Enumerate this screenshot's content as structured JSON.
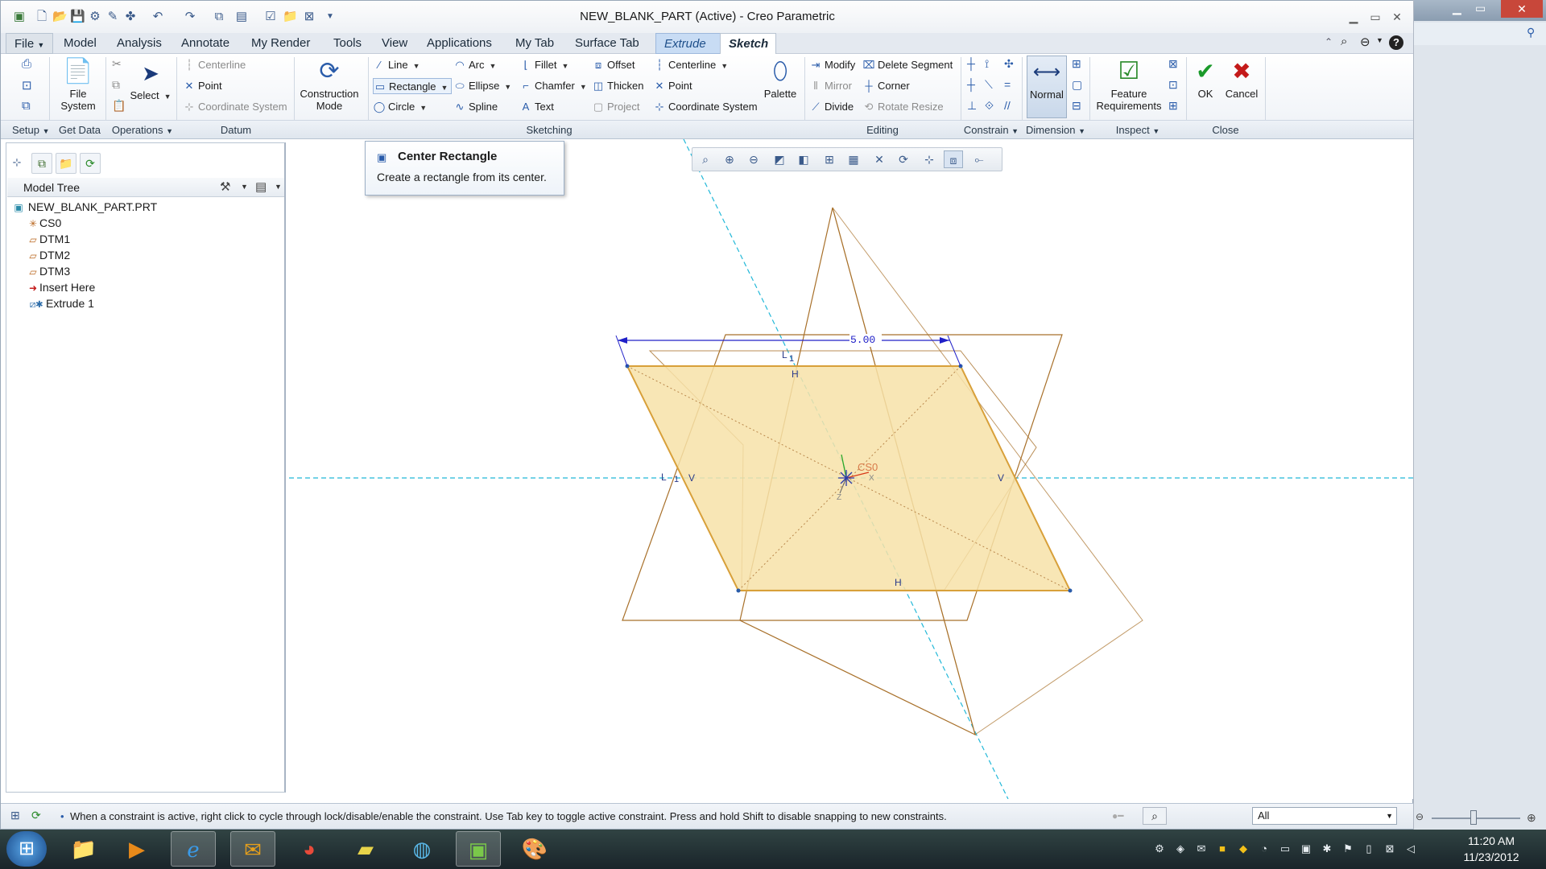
{
  "window": {
    "title": "NEW_BLANK_PART (Active) - Creo Parametric"
  },
  "tabs": [
    {
      "label": "File",
      "state": "file"
    },
    {
      "label": "Model",
      "state": "normal"
    },
    {
      "label": "Analysis",
      "state": "normal"
    },
    {
      "label": "Annotate",
      "state": "normal"
    },
    {
      "label": "My Render",
      "state": "normal"
    },
    {
      "label": "Tools",
      "state": "normal"
    },
    {
      "label": "View",
      "state": "normal"
    },
    {
      "label": "Applications",
      "state": "normal"
    },
    {
      "label": "My Tab",
      "state": "normal"
    },
    {
      "label": "Surface Tab",
      "state": "normal"
    },
    {
      "label": "Extrude",
      "state": "context"
    },
    {
      "label": "Sketch",
      "state": "active"
    }
  ],
  "ribbon": {
    "file_system": "File\nSystem",
    "select": "Select",
    "datum": {
      "centerline": "Centerline",
      "point": "Point",
      "coordinate_system": "Coordinate System"
    },
    "construction_mode": "Construction\nMode",
    "sketching": {
      "line": "Line",
      "rectangle": "Rectangle",
      "circle": "Circle",
      "arc": "Arc",
      "ellipse": "Ellipse",
      "spline": "Spline",
      "fillet": "Fillet",
      "chamfer": "Chamfer",
      "text": "Text",
      "offset": "Offset",
      "thicken": "Thicken",
      "project": "Project",
      "centerline": "Centerline",
      "point": "Point",
      "coordinate_system": "Coordinate System",
      "palette": "Palette"
    },
    "editing": {
      "modify": "Modify",
      "delete_segment": "Delete Segment",
      "mirror": "Mirror",
      "corner": "Corner",
      "divide": "Divide",
      "rotate_resize": "Rotate Resize"
    },
    "dimension": {
      "normal": "Normal"
    },
    "inspect": {
      "feature_requirements": "Feature\nRequirements"
    },
    "close": {
      "ok": "OK",
      "cancel": "Cancel"
    }
  },
  "group_labels": {
    "setup": "Setup",
    "get_data": "Get Data",
    "operations": "Operations",
    "datum": "Datum",
    "sketching": "Sketching",
    "editing": "Editing",
    "constrain": "Constrain",
    "dimension": "Dimension",
    "inspect": "Inspect",
    "close": "Close"
  },
  "model_tree": {
    "title": "Model Tree",
    "items": [
      {
        "label": "NEW_BLANK_PART.PRT",
        "icon": "part-icon",
        "indent": 0
      },
      {
        "label": "CS0",
        "icon": "coordinate-system-icon",
        "indent": 1
      },
      {
        "label": "DTM1",
        "icon": "datum-plane-icon",
        "indent": 1
      },
      {
        "label": "DTM2",
        "icon": "datum-plane-icon",
        "indent": 1
      },
      {
        "label": "DTM3",
        "icon": "datum-plane-icon",
        "indent": 1
      },
      {
        "label": "Insert Here",
        "icon": "insert-arrow-icon",
        "indent": 1
      },
      {
        "label": "Extrude 1",
        "icon": "extrude-icon",
        "indent": 1
      }
    ]
  },
  "tooltip": {
    "title": "Center Rectangle",
    "text": "Create a rectangle from its center."
  },
  "sketch": {
    "dimension": "5.00",
    "cs_label": "CS0",
    "constraint_L": "L",
    "constraint_L1": "1",
    "constraint_H": "H",
    "constraint_V": "V",
    "axis_z": "Z",
    "axis_x": "X"
  },
  "status": {
    "message": "When a constraint is active, right click to cycle through lock/disable/enable the constraint. Use Tab key to toggle active constraint. Press and hold Shift to disable snapping to new constraints.",
    "filter": "All"
  },
  "clock": {
    "time": "11:20 AM",
    "date": "11/23/2012"
  },
  "colors": {
    "sketch_fill": "#f7e2a8",
    "sketch_edge": "#a8702a",
    "dimension": "#2020c8",
    "centerline": "#22b8d8",
    "context_tab": "#c8dcf4"
  }
}
